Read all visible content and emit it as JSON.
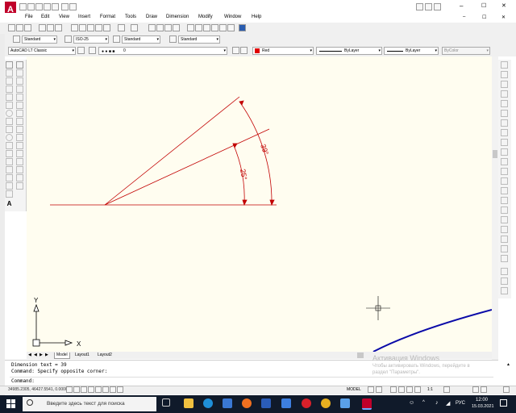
{
  "app": {
    "logo_letter": "A",
    "logo_color": "#c0002a"
  },
  "window_controls": {
    "minimize": "–",
    "maximize": "☐",
    "close": "✕"
  },
  "inner_controls": [
    "–",
    "☐",
    "✕"
  ],
  "menu": [
    "File",
    "Edit",
    "View",
    "Insert",
    "Format",
    "Tools",
    "Draw",
    "Dimension",
    "Modify",
    "Window",
    "Help"
  ],
  "styles": {
    "text_style": "Standard",
    "dim_style": "ISO-25",
    "table_style": "Standard",
    "mleader_style": "Standard"
  },
  "workspace": {
    "name": "AutoCAD LT Classic",
    "layer": "0",
    "color": "Red",
    "linetype": "ByLayer",
    "lineweight": "ByLayer",
    "plotstyle": "ByColor",
    "color_hex": "#e00000"
  },
  "drawing": {
    "angle_outer_label": "39°",
    "angle_inner_label": "25°",
    "line_color": "#c20000",
    "polyline_color": "#0a0aa8",
    "ucs_y": "Y",
    "ucs_x": "X"
  },
  "tabs": {
    "model": "Model",
    "layout1": "Layout1",
    "layout2": "Layout2"
  },
  "command": {
    "line1": "Dimension text = 39",
    "line2": "Command: Specify opposite corner:",
    "prompt": "Command:"
  },
  "watermark": {
    "title": "Активация Windows",
    "body_line1": "Чтобы активировать Windows, перейдите в",
    "body_line2": "раздел \"Параметры\"."
  },
  "status": {
    "coords": "34985.2305, 46427.5541, 0.0000",
    "model_label": "MODEL",
    "scale": "1:1"
  },
  "taskbar": {
    "search_placeholder": "Введите здесь текст для поиска",
    "lang": "РУС",
    "time": "12:00",
    "date": "15.03.2021"
  }
}
